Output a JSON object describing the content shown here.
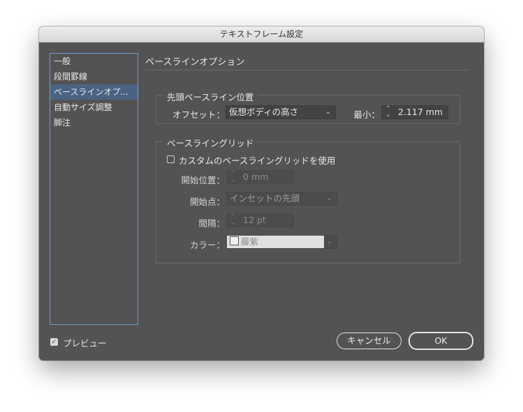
{
  "window": {
    "title": "テキストフレーム設定"
  },
  "sidebar": {
    "items": [
      {
        "label": "一般"
      },
      {
        "label": "段間罫線"
      },
      {
        "label": "ベースラインオプ..."
      },
      {
        "label": "自動サイズ調整"
      },
      {
        "label": "脚注"
      }
    ],
    "selected_index": 2
  },
  "main": {
    "title": "ベースラインオプション",
    "first_baseline": {
      "group_label": "先頭ベースライン位置",
      "offset_label": "オフセット：",
      "offset_value": "仮想ボディの高さ",
      "min_label": "最小：",
      "min_value": "2.117 mm"
    },
    "grid": {
      "group_label": "ベースライングリッド",
      "custom_checkbox_label": "カスタムのベースライングリッドを使用",
      "custom_checked": false,
      "start_position_label": "開始位置：",
      "start_position_value": "0 mm",
      "start_point_label": "開始点：",
      "start_point_value": "インセットの先頭",
      "interval_label": "間隔：",
      "interval_value": "12 pt",
      "color_label": "カラー：",
      "color_value": "藤紫"
    }
  },
  "footer": {
    "preview_label": "プレビュー",
    "preview_checked": true,
    "cancel_label": "キャンセル",
    "ok_label": "OK"
  },
  "icons": {
    "chevron": "chevron-down-icon",
    "stepper": "stepper-icon",
    "check": "checkmark-icon"
  },
  "colors": {
    "panel_bg": "#535353",
    "selection_bg": "#4a6384",
    "sidebar_border": "#6f9ad0"
  }
}
